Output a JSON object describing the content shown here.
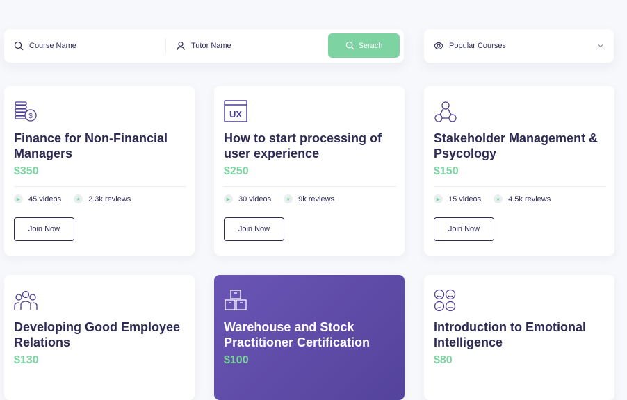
{
  "search": {
    "course_placeholder": "Course Name",
    "tutor_placeholder": "Tutor Name",
    "button_label": "Serach"
  },
  "filter": {
    "selected": "Popular Courses"
  },
  "courses": [
    {
      "title": "Finance for Non-Financial Managers",
      "price": "$350",
      "videos": "45 videos",
      "reviews": "2.3k reviews",
      "cta": "Join Now",
      "icon": "coins-dollar-icon"
    },
    {
      "title": "How to start processing of user experience",
      "price": "$250",
      "videos": "30 videos",
      "reviews": "9k reviews",
      "cta": "Join Now",
      "icon": "ux-window-icon"
    },
    {
      "title": "Stakeholder Management & Psycology",
      "price": "$150",
      "videos": "15 videos",
      "reviews": "4.5k reviews",
      "cta": "Join Now",
      "icon": "network-people-icon"
    },
    {
      "title": "Developing Good Employee Relations",
      "price": "$130",
      "icon": "people-group-icon"
    },
    {
      "title": "Warehouse and Stock Practitioner Certification",
      "price": "$100",
      "icon": "boxes-icon"
    },
    {
      "title": "Introduction to Emotional Intelligence",
      "price": "$80",
      "icon": "emotion-faces-icon"
    }
  ],
  "colors": {
    "accent_green": "#7dd3a1",
    "text_dark": "#2d2b55",
    "featured_purple": "#5e4aa8"
  }
}
